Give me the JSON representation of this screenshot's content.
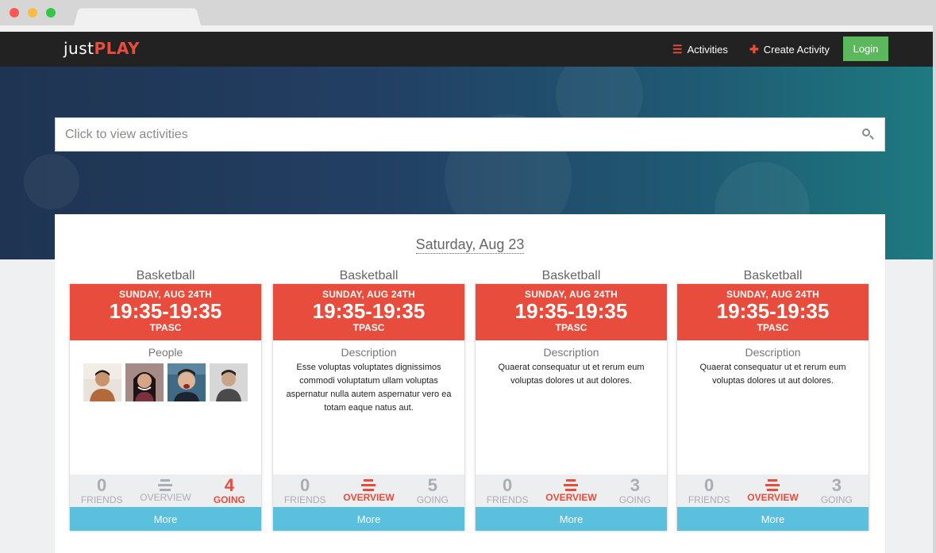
{
  "navbar": {
    "logo_just": "just",
    "logo_play": "PLAY",
    "activities_label": "Activities",
    "create_label": "Create Activity",
    "login_label": "Login"
  },
  "search": {
    "placeholder": "Click to view activities"
  },
  "main": {
    "date_heading": "Saturday, Aug 23",
    "cards": [
      {
        "title": "Basketball",
        "day": "SUNDAY, AUG 24TH",
        "time": "19:35-19:35",
        "venue": "TPASC",
        "section_title": "People",
        "description": "",
        "people": [
          "person-1",
          "person-2",
          "person-3",
          "person-4"
        ],
        "friends_count": "0",
        "friends_label": "FRIENDS",
        "overview_label": "OVERVIEW",
        "going_count": "4",
        "going_label": "GOING",
        "active_tab": "going",
        "more_label": "More"
      },
      {
        "title": "Basketball",
        "day": "SUNDAY, AUG 24TH",
        "time": "19:35-19:35",
        "venue": "TPASC",
        "section_title": "Description",
        "description": "Esse voluptas voluptates dignissimos commodi voluptatum ullam voluptas aspernatur nulla autem aspernatur vero ea totam eaque natus aut.",
        "friends_count": "0",
        "friends_label": "FRIENDS",
        "overview_label": "OVERVIEW",
        "going_count": "5",
        "going_label": "GOING",
        "active_tab": "overview",
        "more_label": "More"
      },
      {
        "title": "Basketball",
        "day": "SUNDAY, AUG 24TH",
        "time": "19:35-19:35",
        "venue": "TPASC",
        "section_title": "Description",
        "description": "Quaerat consequatur ut et rerum eum voluptas dolores ut aut dolores.",
        "friends_count": "0",
        "friends_label": "FRIENDS",
        "overview_label": "OVERVIEW",
        "going_count": "3",
        "going_label": "GOING",
        "active_tab": "overview",
        "more_label": "More"
      },
      {
        "title": "Basketball",
        "day": "SUNDAY, AUG 24TH",
        "time": "19:35-19:35",
        "venue": "TPASC",
        "section_title": "Description",
        "description": "Quaerat consequatur ut et rerum eum voluptas dolores ut aut dolores.",
        "friends_count": "0",
        "friends_label": "FRIENDS",
        "overview_label": "OVERVIEW",
        "going_count": "3",
        "going_label": "GOING",
        "active_tab": "overview",
        "more_label": "More"
      }
    ]
  },
  "colors": {
    "accent_red": "#e74c3c",
    "login_green": "#5cb85c",
    "more_blue": "#5bc0de",
    "navbar_bg": "#222222"
  }
}
